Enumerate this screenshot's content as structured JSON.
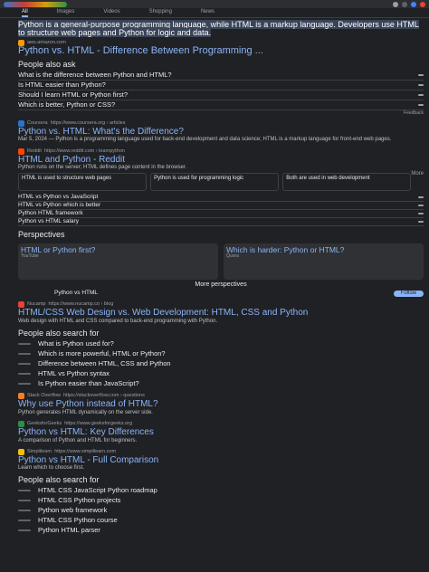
{
  "topbar": {
    "brand_colors": [
      "#4285f4",
      "#ea4335",
      "#fbbc05",
      "#34a853"
    ]
  },
  "tabs": [
    "All",
    "Images",
    "Videos",
    "Shopping",
    "News"
  ],
  "ai": {
    "headline": "Python is a general-purpose programming language, while HTML is a markup language. Developers use HTML to structure web pages and Python for logic and data.",
    "source": "aws.amazon.com"
  },
  "top_link": {
    "title": "Python vs. HTML - Difference Between Programming ..."
  },
  "paa": {
    "title": "People also ask",
    "items": [
      "What is the difference between Python and HTML?",
      "Is HTML easier than Python?",
      "Should I learn HTML or Python first?",
      "Which is better, Python or CSS?"
    ],
    "feedback": "Feedback"
  },
  "results": [
    {
      "site": "Coursera",
      "url": "https://www.coursera.org › articles",
      "title": "Python vs. HTML: What's the Difference?",
      "snippet": "Python is a programming language used for back-end development and data science; HTML is a markup language for front-end web pages.",
      "date": "Mar 5, 2024"
    },
    {
      "site": "Reddit",
      "url": "https://www.reddit.com › learnpython",
      "title": "HTML and Python - Reddit",
      "snippet": "Python runs on the server; HTML defines page content in the browser.",
      "more": "More"
    }
  ],
  "compare": {
    "cols": [
      "HTML is used to structure web pages",
      "Python is used for programming logic",
      "Both are used in web development"
    ]
  },
  "subqs": [
    "HTML vs Python vs JavaScript",
    "HTML vs Python which is better",
    "Python HTML framework",
    "Python vs HTML salary"
  ],
  "perspectives": {
    "title": "Perspectives",
    "cards": [
      {
        "title": "HTML or Python first?",
        "source": "YouTube"
      },
      {
        "title": "Which is harder: Python or HTML?",
        "source": "Quora"
      }
    ],
    "follow": "Follow",
    "more": "More perspectives",
    "author": "Python vs HTML"
  },
  "results2": [
    {
      "site": "Nucamp",
      "url": "https://www.nucamp.co › blog",
      "title": "HTML/CSS Web Design vs. Web Development: HTML, CSS and Python",
      "snippet": "Web design with HTML and CSS compared to back-end programming with Python."
    },
    {
      "site": "Stack Overflow",
      "url": "https://stackoverflow.com › questions",
      "title": "Why use Python instead of HTML?",
      "snippet": "Python generates HTML dynamically on the server side."
    },
    {
      "site": "GeeksforGeeks",
      "url": "https://www.geeksforgeeks.org",
      "title": "Python vs HTML: Key Differences",
      "snippet": "A comparison of Python and HTML for beginners."
    },
    {
      "site": "Simplilearn",
      "url": "https://www.simplilearn.com",
      "title": "Python vs HTML - Full Comparison",
      "snippet": "Learn which to choose first."
    }
  ],
  "qlist": {
    "title": "People also search for",
    "items": [
      "What is Python used for?",
      "Which is more powerful, HTML or Python?",
      "Difference between HTML, CSS and Python",
      "HTML vs Python syntax",
      "Is Python easier than JavaScript?"
    ]
  },
  "qlist2": {
    "title": "People also search for",
    "items": [
      "HTML CSS JavaScript Python roadmap",
      "HTML CSS Python projects",
      "Python web framework",
      "HTML CSS Python course",
      "Python HTML parser"
    ]
  }
}
